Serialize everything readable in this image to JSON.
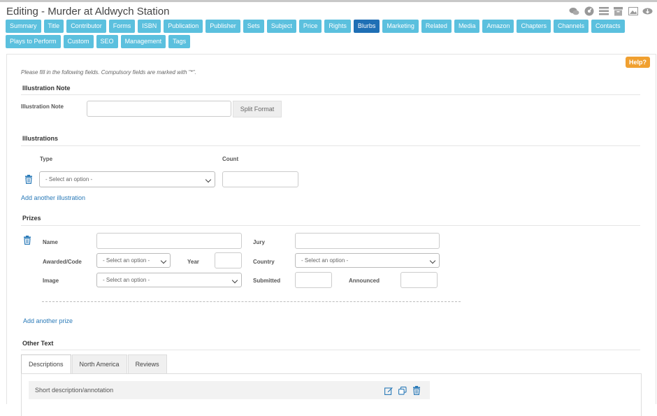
{
  "page": {
    "title": "Editing - Murder at Aldwych Station"
  },
  "top_icons": [
    "chat-icon",
    "dashboard-icon",
    "list-icon",
    "archive-icon",
    "image-icon",
    "cloud-download-icon"
  ],
  "tabs": [
    "Summary",
    "Title",
    "Contributor",
    "Forms",
    "ISBN",
    "Publication",
    "Publisher",
    "Sets",
    "Subject",
    "Price",
    "Rights",
    "Blurbs",
    "Marketing",
    "Related",
    "Media",
    "Amazon",
    "Chapters",
    "Channels",
    "Contacts",
    "Plays to Perform",
    "Custom",
    "SEO",
    "Management",
    "Tags"
  ],
  "active_tab": "Blurbs",
  "help_label": "Help?",
  "hint": "Please fill in the following fields. Compulsory fields are marked with \"*\".",
  "illustration_note": {
    "section": "Illustration Note",
    "label": "Illustration Note",
    "value": "",
    "split_button": "Split Format"
  },
  "illustrations": {
    "section": "Illustrations",
    "col_type": "Type",
    "col_count": "Count",
    "type_select": "- Select an option -",
    "count_value": "",
    "add_link": "Add another illustration"
  },
  "prizes": {
    "section": "Prizes",
    "name_label": "Name",
    "jury_label": "Jury",
    "awarded_label": "Awarded/Code",
    "awarded_select": "- Select an option -",
    "year_label": "Year",
    "country_label": "Country",
    "country_select": "- Select an option -",
    "image_label": "Image",
    "image_select": "- Select an option -",
    "submitted_label": "Submitted",
    "announced_label": "Announced",
    "add_link": "Add another prize"
  },
  "other_text": {
    "section": "Other Text",
    "tabs": [
      "Descriptions",
      "North America",
      "Reviews"
    ],
    "active": "Descriptions",
    "row_label": "Short description/annotation"
  },
  "colors": {
    "tab": "#5bc0de",
    "tab_active": "#1f6fb5",
    "help": "#f0a030",
    "link": "#2a7ab8"
  }
}
